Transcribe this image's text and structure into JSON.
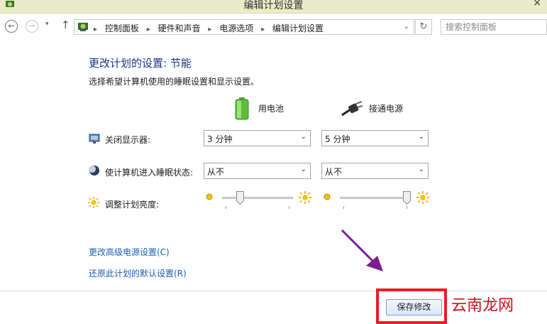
{
  "window": {
    "title": "编辑计划设置",
    "close_glyph": "×"
  },
  "nav": {
    "back_glyph": "←",
    "forward_glyph": "→",
    "history_glyph": "▾",
    "up_glyph": "↑",
    "breadcrumbs": [
      "控制面板",
      "硬件和声音",
      "电源选项",
      "编辑计划设置"
    ],
    "breadcrumb_separator": "▸",
    "address_dropdown_glyph": "⌄",
    "refresh_glyph": "↻",
    "search_placeholder": "搜索控制面板"
  },
  "main": {
    "title": "更改计划的设置: 节能",
    "subtitle": "选择希望计算机使用的睡眠设置和显示设置。",
    "columns": [
      {
        "label": "用电池",
        "icon": "battery-icon"
      },
      {
        "label": "接通电源",
        "icon": "power-plug-icon"
      }
    ],
    "settings": [
      {
        "label": "关闭显示器:",
        "icon": "monitor-icon",
        "battery": "3 分钟",
        "plugged": "5 分钟"
      },
      {
        "label": "使计算机进入睡眠状态:",
        "icon": "sleep-moon-icon",
        "battery": "从不",
        "plugged": "从不"
      }
    ],
    "brightness": {
      "label": "调整计划亮度:",
      "icon": "brightness-sun-icon",
      "battery_level": 0.22,
      "plugged_level": 1.0
    },
    "select_arrow_glyph": "⌄",
    "links": [
      "更改高级电源设置(C)",
      "还原此计划的默认设置(R)"
    ]
  },
  "footer": {
    "save_label": "保存修改"
  },
  "watermark": {
    "text": "云南龙网"
  },
  "colors": {
    "title_blue": "#1e3287",
    "link_blue": "#1a5fb4",
    "highlight_red": "#ec1c24",
    "arrow_purple": "#7b1f8f"
  }
}
